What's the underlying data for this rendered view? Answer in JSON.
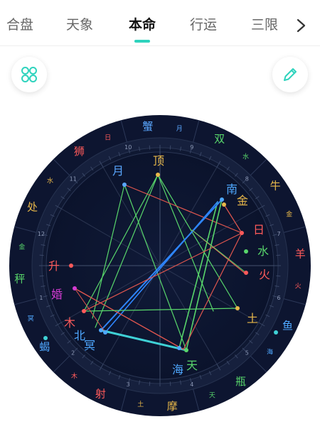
{
  "tabs": [
    {
      "label": "合盘",
      "active": false
    },
    {
      "label": "天象",
      "active": false
    },
    {
      "label": "本命",
      "active": true
    },
    {
      "label": "行运",
      "active": false
    },
    {
      "label": "三限",
      "active": false
    }
  ],
  "toolbar": {
    "layout_icon": "four-circles-icon",
    "edit_icon": "pencil-icon"
  },
  "colors": {
    "accent": "#2ed3bd",
    "chart_bg": "#0d1530",
    "ring_bg": "#16203d",
    "line_blue": "#2f86ff",
    "line_green": "#58d66b",
    "line_red": "#e0564e"
  },
  "chart": {
    "signs": [
      {
        "label": "蟹",
        "ruler": "月",
        "color": "#5aa7ff"
      },
      {
        "label": "双",
        "ruler": "水",
        "color": "#58d66b"
      },
      {
        "label": "牛",
        "ruler": "金",
        "color": "#e8b84a"
      },
      {
        "label": "羊",
        "ruler": "火",
        "color": "#ff5a5a"
      },
      {
        "label": "鱼",
        "ruler": "海",
        "color": "#4fa8ff"
      },
      {
        "label": "瓶",
        "ruler": "天",
        "color": "#58d66b"
      },
      {
        "label": "摩",
        "ruler": "土",
        "color": "#e8b84a"
      },
      {
        "label": "射",
        "ruler": "木",
        "color": "#ff5a5a"
      },
      {
        "label": "蝎",
        "ruler": "冥",
        "color": "#4fa8ff"
      },
      {
        "label": "秤",
        "ruler": "金",
        "color": "#58d66b"
      },
      {
        "label": "处",
        "ruler": "水",
        "color": "#e8b84a"
      },
      {
        "label": "狮",
        "ruler": "日",
        "color": "#ff5a5a"
      }
    ],
    "house_numbers": [
      "1",
      "2",
      "3",
      "4",
      "5",
      "6",
      "7",
      "8",
      "9",
      "10",
      "11",
      "12"
    ],
    "planets": [
      {
        "label": "顶",
        "color": "#e8b84a"
      },
      {
        "label": "月",
        "color": "#5aa7ff"
      },
      {
        "label": "南",
        "color": "#4fa8ff"
      },
      {
        "label": "金",
        "color": "#e8b84a"
      },
      {
        "label": "日",
        "color": "#ff5a5a"
      },
      {
        "label": "水",
        "color": "#58d66b"
      },
      {
        "label": "火",
        "color": "#ff5a5a"
      },
      {
        "label": "土",
        "color": "#e8b84a"
      },
      {
        "label": "升",
        "color": "#ff5a5a"
      },
      {
        "label": "婚",
        "color": "#d23cd2"
      },
      {
        "label": "木",
        "color": "#ff5a5a"
      },
      {
        "label": "北",
        "color": "#4fa8ff"
      },
      {
        "label": "冥",
        "color": "#4fa8ff"
      },
      {
        "label": "海",
        "color": "#4fa8ff"
      },
      {
        "label": "天",
        "color": "#58d66b"
      }
    ]
  }
}
